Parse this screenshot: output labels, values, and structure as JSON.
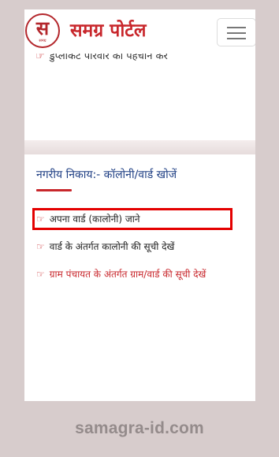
{
  "header": {
    "logo_text": "स",
    "logo_subtext": "समग्र",
    "brand_title": "समग्र पोर्टल",
    "menu_icon": "hamburger-menu-icon"
  },
  "previous_section": {
    "partial_link": "डुप्लीकेट परिवार की पहचान करें",
    "icon": "hand-pointing-right-icon"
  },
  "section": {
    "title": "नगरीय निकाय:- कॉलोनी/वार्ड खोजें",
    "links": [
      {
        "label": "अपना वार्ड (कालोनी) जाने",
        "icon": "hand-pointing-right-icon",
        "highlighted": true
      },
      {
        "label": "वार्ड के अंतर्गत कालोनी की सूची देखें",
        "icon": "hand-pointing-right-icon"
      },
      {
        "label": "ग्राम पंचायत के अंतर्गत ग्राम/वार्ड की सूची देखें",
        "icon": "hand-pointing-right-icon",
        "color": "#c8272c"
      }
    ]
  },
  "colors": {
    "brand_red": "#c8272c",
    "title_blue": "#1f3f84",
    "highlight_red": "#e40000",
    "background": "#d7cccc"
  },
  "watermark": "samagra-id.com"
}
